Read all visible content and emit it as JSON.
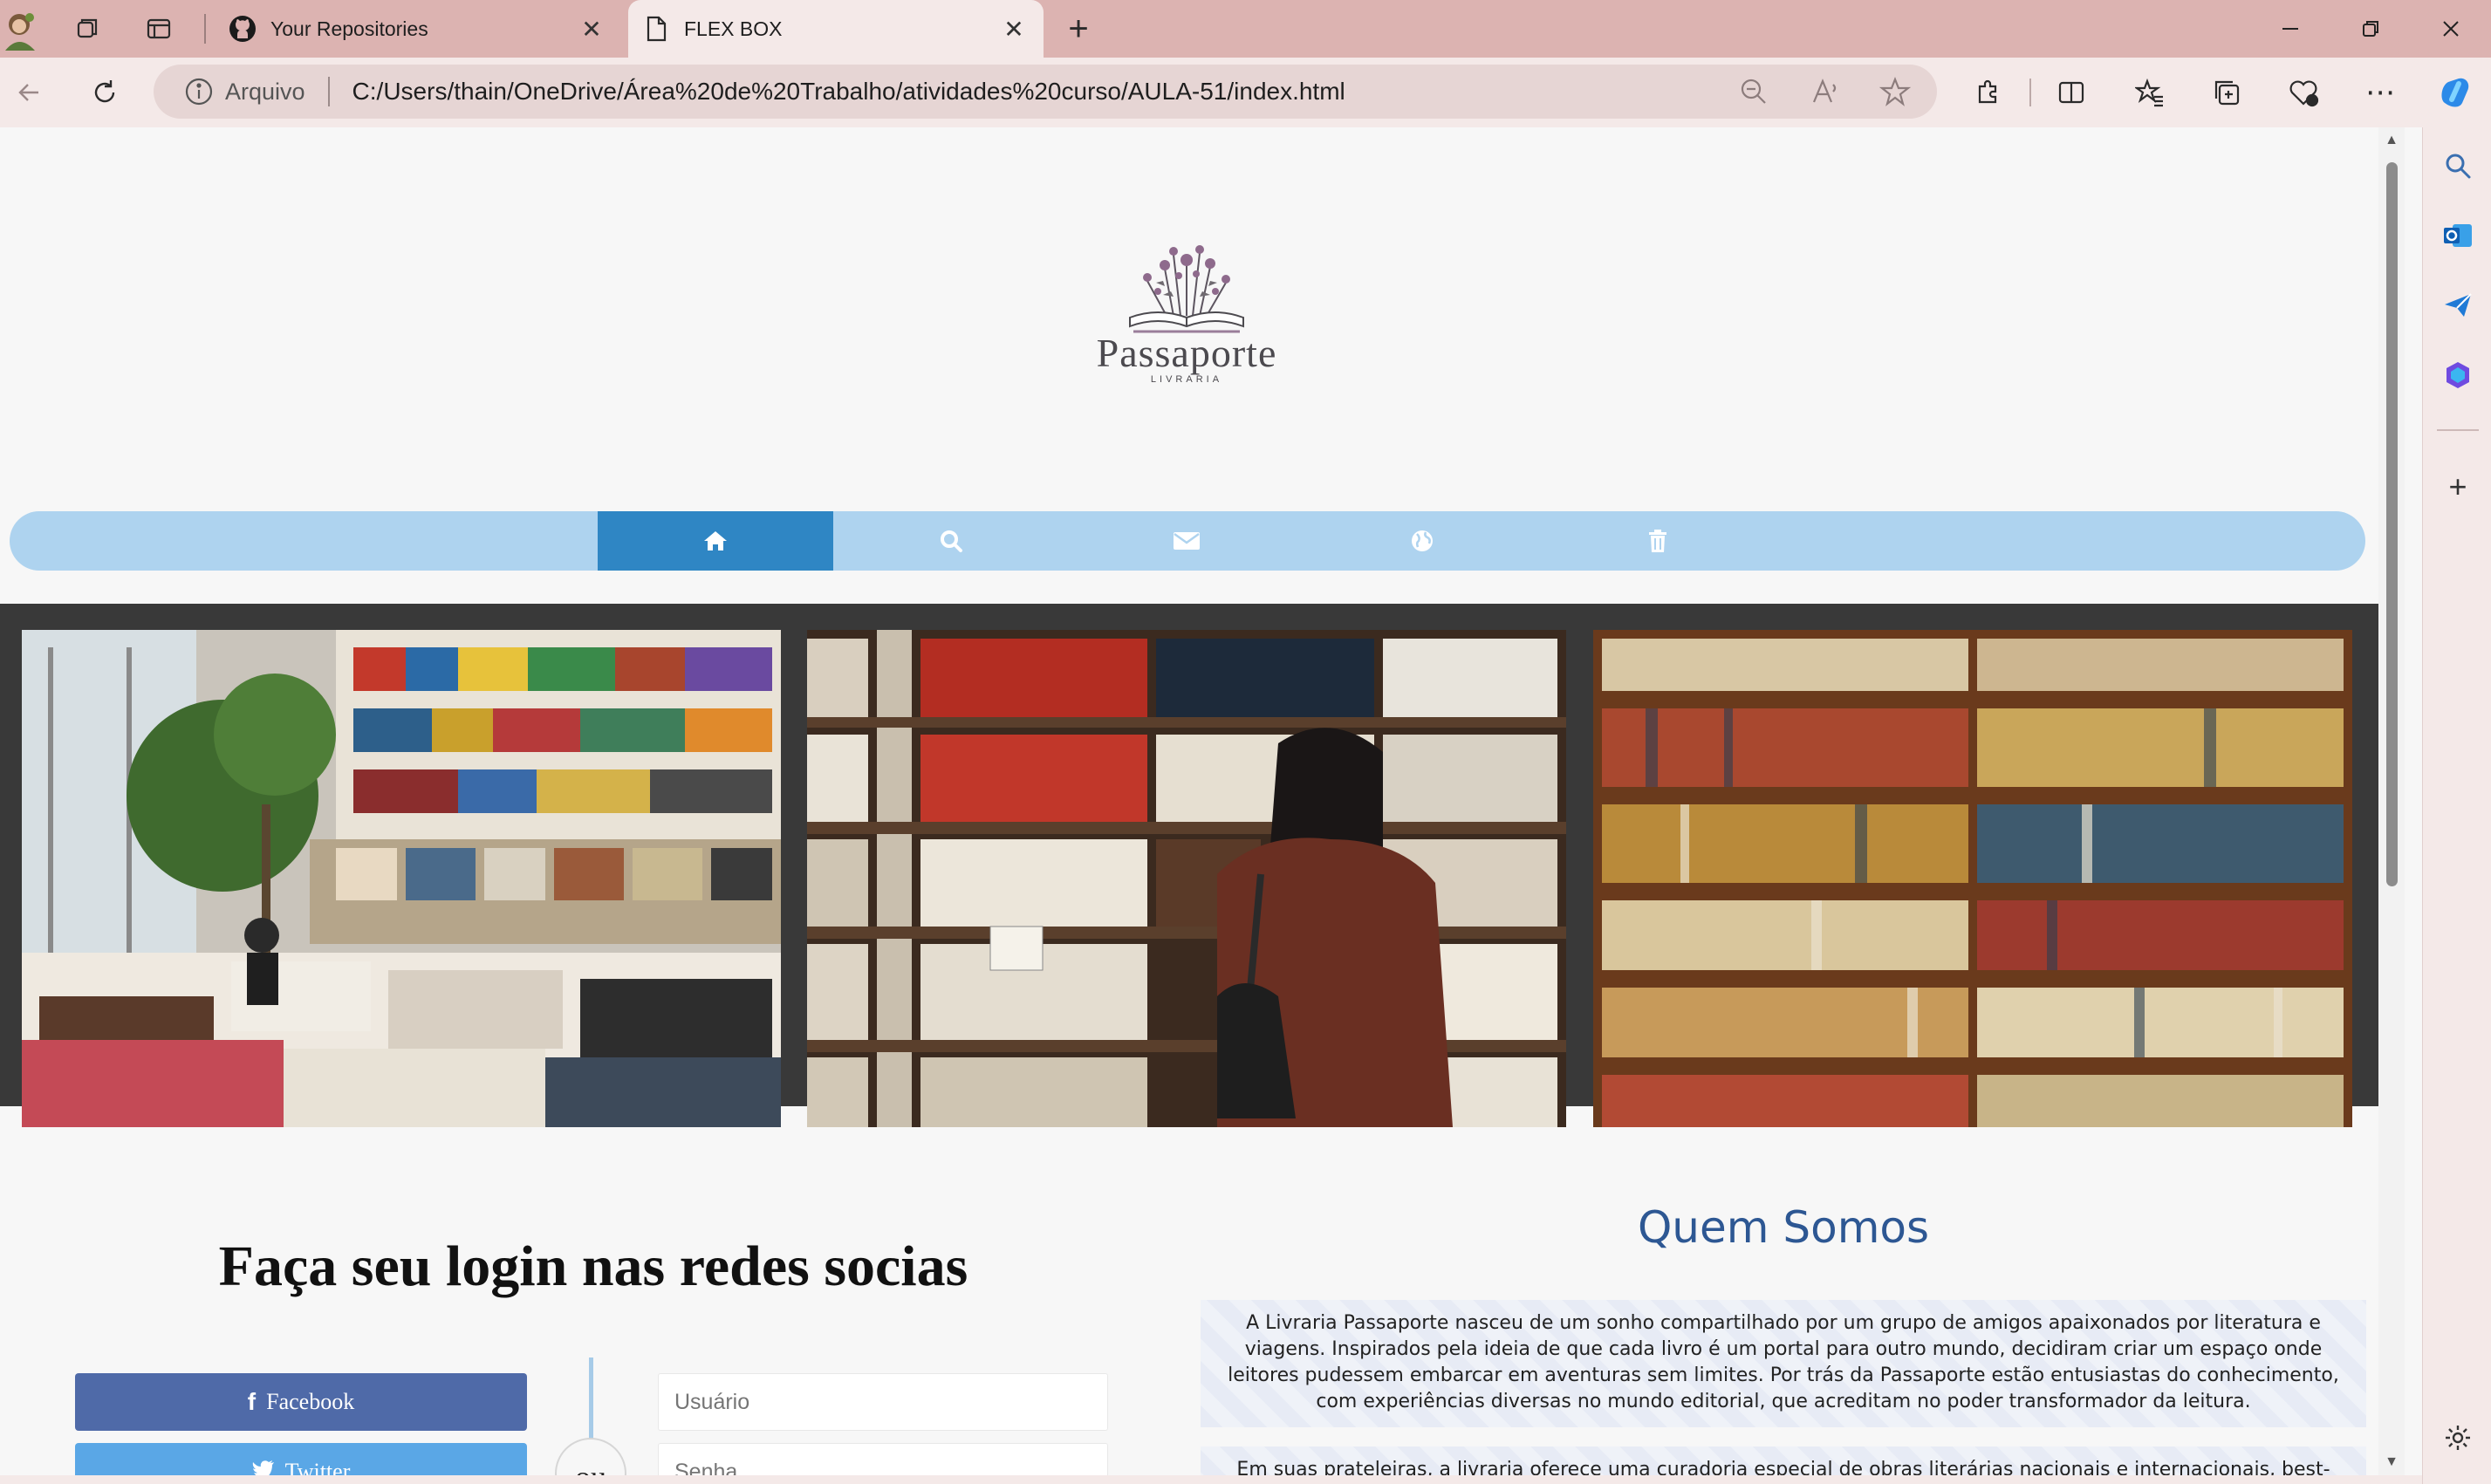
{
  "browser": {
    "tabs": [
      {
        "title": "Your Repositories",
        "icon": "github-icon",
        "active": false
      },
      {
        "title": "FLEX BOX",
        "icon": "page-icon",
        "active": true
      }
    ],
    "address": {
      "scheme_label": "Arquivo",
      "url": "C:/Users/thain/OneDrive/Área%20de%20Trabalho/atividades%20curso/AULA-51/index.html"
    },
    "colors": {
      "tabbar": "#dcb3b1",
      "toolbar": "#f4e9e8",
      "address_pill": "#e6d5d4"
    }
  },
  "page": {
    "logo": {
      "name": "Passaporte",
      "subtitle": "LIVRARIA"
    },
    "nav": [
      {
        "icon": "home-icon",
        "active": true
      },
      {
        "icon": "search-icon",
        "active": false
      },
      {
        "icon": "envelope-icon",
        "active": false
      },
      {
        "icon": "globe-icon",
        "active": false
      },
      {
        "icon": "trash-icon",
        "active": false
      }
    ],
    "nav_colors": {
      "bar": "#aed3ef",
      "active": "#2f86c4"
    },
    "gallery": [
      {
        "icon": "bookstore-photo"
      },
      {
        "icon": "woman-at-bookshelf-photo"
      },
      {
        "icon": "bookshelf-photo"
      }
    ],
    "login": {
      "title": "Faça seu login nas redes socias",
      "facebook_label": "Facebook",
      "twitter_label": "Twitter",
      "or_label": "ou",
      "username_placeholder": "Usuário",
      "password_placeholder": "Senha"
    },
    "about": {
      "title": "Quem Somos",
      "paragraph1": "A Livraria Passaporte nasceu de um sonho compartilhado por um grupo de amigos apaixonados por literatura e viagens. Inspirados pela ideia de que cada livro é um portal para outro mundo, decidiram criar um espaço onde leitores pudessem embarcar em aventuras sem limites. Por trás da Passaporte estão entusiastas do conhecimento, com experiências diversas no mundo editorial, que acreditam no poder transformador da leitura.",
      "paragraph2": "Em suas prateleiras, a livraria oferece uma curadoria especial de obras literárias nacionais e internacionais, best-sellers e"
    }
  }
}
